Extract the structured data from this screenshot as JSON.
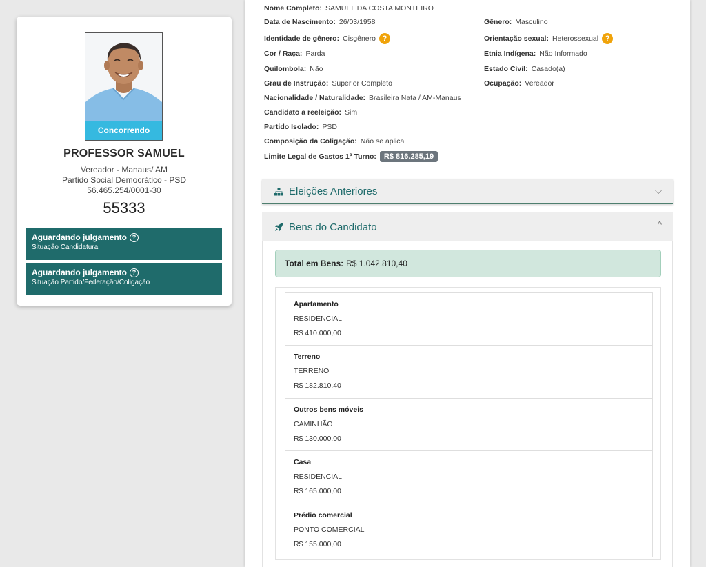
{
  "candidate": {
    "photo_badge": "Concorrendo",
    "name": "PROFESSOR SAMUEL",
    "office": "Vereador - Manaus/ AM",
    "party": "Partido Social Democrático - PSD",
    "cnpj": "56.465.254/0001-30",
    "number": "55333",
    "status": [
      {
        "title": "Aguardando julgamento",
        "sub": "Situação Candidatura"
      },
      {
        "title": "Aguardando julgamento",
        "sub": "Situação Partido/Federação/Coligação"
      }
    ]
  },
  "details": {
    "nome_completo": {
      "label": "Nome Completo:",
      "value": "SAMUEL DA COSTA MONTEIRO"
    },
    "data_nascimento": {
      "label": "Data de Nascimento:",
      "value": "26/03/1958"
    },
    "genero": {
      "label": "Gênero:",
      "value": "Masculino"
    },
    "identidade_genero": {
      "label": "Identidade de gênero:",
      "value": "Cisgênero"
    },
    "orientacao_sexual": {
      "label": "Orientação sexual:",
      "value": "Heterossexual"
    },
    "cor_raca": {
      "label": "Cor / Raça:",
      "value": "Parda"
    },
    "etnia_indigena": {
      "label": "Etnia Indígena:",
      "value": "Não Informado"
    },
    "quilombola": {
      "label": "Quilombola:",
      "value": "Não"
    },
    "estado_civil": {
      "label": "Estado Civil:",
      "value": "Casado(a)"
    },
    "grau_instrucao": {
      "label": "Grau de Instrução:",
      "value": "Superior Completo"
    },
    "ocupacao": {
      "label": "Ocupação:",
      "value": "Vereador"
    },
    "nacionalidade": {
      "label": "Nacionalidade / Naturalidade:",
      "value": "Brasileira Nata / AM-Manaus"
    },
    "reeleicao": {
      "label": "Candidato a reeleição:",
      "value": "Sim"
    },
    "partido_isolado": {
      "label": "Partido Isolado:",
      "value": "PSD"
    },
    "composicao": {
      "label": "Composição da Coligação:",
      "value": "Não se aplica"
    },
    "limite_gastos": {
      "label": "Limite Legal de Gastos 1º Turno:",
      "value": "R$ 816.285,19"
    },
    "help_glyph": "?"
  },
  "sections": {
    "eleicoes_anteriores": "Eleições Anteriores",
    "bens_candidato": "Bens do Candidato",
    "chevron_down": "⌵",
    "chevron_up": "^"
  },
  "bens": {
    "total_label": "Total em Bens:",
    "total_value": "R$ 1.042.810,40",
    "items": [
      {
        "type": "Apartamento",
        "desc": "RESIDENCIAL",
        "value": "R$ 410.000,00"
      },
      {
        "type": "Terreno",
        "desc": "TERRENO",
        "value": "R$ 182.810,40"
      },
      {
        "type": "Outros bens móveis",
        "desc": "CAMINHÃO",
        "value": "R$ 130.000,00"
      },
      {
        "type": "Casa",
        "desc": "RESIDENCIAL",
        "value": "R$ 165.000,00"
      },
      {
        "type": "Prédio comercial",
        "desc": "PONTO COMERCIAL",
        "value": "R$ 155.000,00"
      }
    ]
  }
}
